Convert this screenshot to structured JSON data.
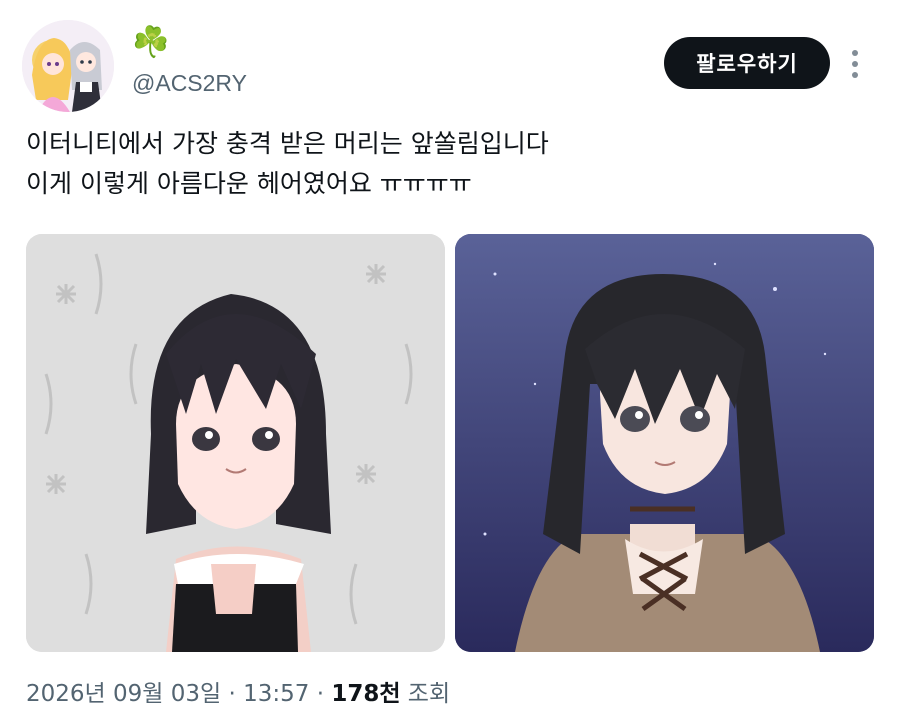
{
  "author": {
    "display_name": "☘️",
    "handle": "@ACS2RY",
    "avatar_icon": "anime-characters-avatar"
  },
  "follow_button": {
    "label": "팔로우하기"
  },
  "more_icon": "more-vertical-icon",
  "tweet": {
    "text": "이터니티에서 가장 충격 받은 머리는 앞쏠림입니다\n이게 이렇게 아름다운 헤어였어요 ㅠㅠㅠㅠ"
  },
  "media": [
    {
      "icon": "low-poly-dark-haired-girl-image"
    },
    {
      "icon": "remastered-dark-haired-girl-image"
    }
  ],
  "meta": {
    "timestamp": "2026년 09월 03일 · 13:57",
    "separator": " · ",
    "views_count": "178천",
    "views_label": " 조회"
  },
  "colors": {
    "text_primary": "#0f1419",
    "text_secondary": "#536471",
    "button_bg": "#0f1419",
    "clover_green": "#2e9b46"
  }
}
